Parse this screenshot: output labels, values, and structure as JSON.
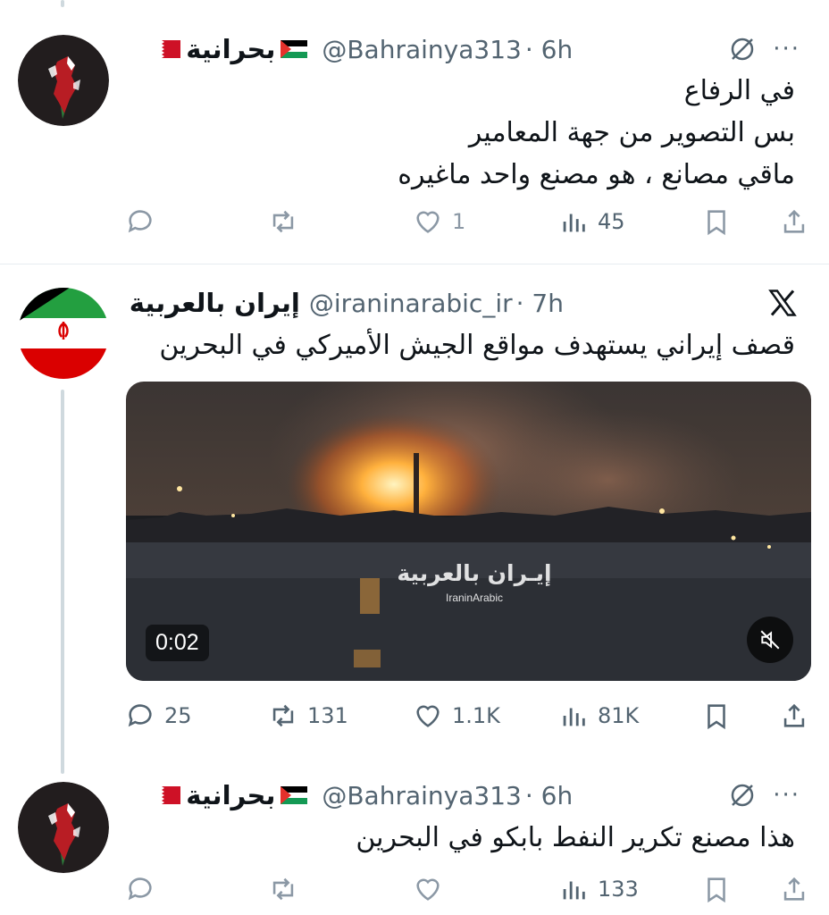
{
  "tweets": [
    {
      "display_name": "بحرانية",
      "handle": "@Bahrainya313",
      "time": "· 6h",
      "lines": [
        "في الرفاع",
        "بس التصوير من جهة المعامير",
        "ماقي مصانع ، هو مصنع واحد ماغيره"
      ],
      "likes": "1",
      "views": "45",
      "header_icon": "grok-slash-icon",
      "more": "···"
    },
    {
      "display_name": "إيران بالعربية",
      "handle": "@iraninarabic_ir",
      "time": "· 7h",
      "lines": [
        "قصف إيراني يستهدف مواقع الجيش الأميركي في البحرين"
      ],
      "replies": "25",
      "retweets": "131",
      "likes": "1.1K",
      "views": "81K",
      "header_icon": "x-logo-icon",
      "video": {
        "duration": "0:02",
        "watermark_title": "إيـران بالعربية",
        "watermark_sub": "IraninArabic"
      }
    },
    {
      "display_name": "بحرانية",
      "handle": "@Bahrainya313",
      "time": "· 6h",
      "lines": [
        "هذا مصنع تكرير النفط بابكو في البحرين"
      ],
      "views": "133",
      "header_icon": "grok-slash-icon",
      "more": "···"
    }
  ],
  "colors": {
    "text_primary": "#0f1419",
    "text_secondary": "#536471",
    "icon_muted": "#8b98a5",
    "thread_line": "#cfd9de"
  }
}
